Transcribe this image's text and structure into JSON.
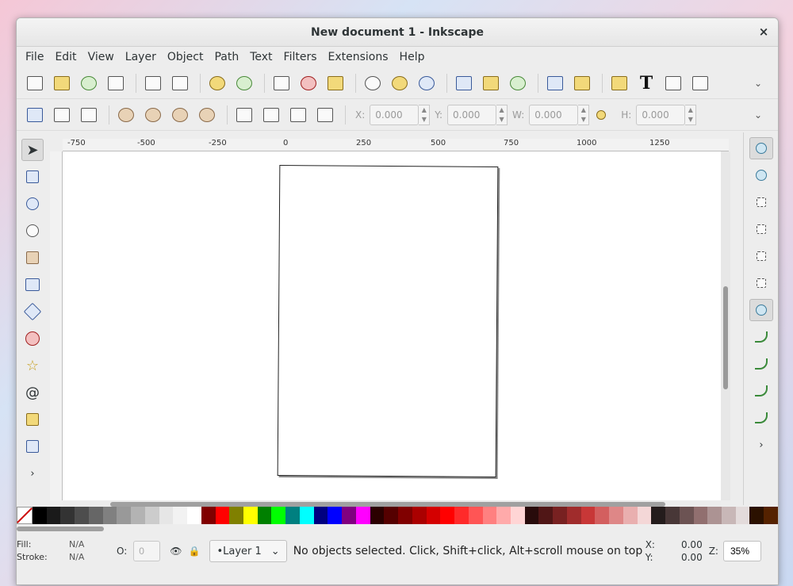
{
  "window": {
    "title": "New document 1 - Inkscape",
    "close": "×"
  },
  "menu": [
    "File",
    "Edit",
    "View",
    "Layer",
    "Object",
    "Path",
    "Text",
    "Filters",
    "Extensions",
    "Help"
  ],
  "toolbar": {
    "text_tool_glyph": "T",
    "more": "⌄"
  },
  "coords": {
    "x_label": "X:",
    "x_value": "0.000",
    "y_label": "Y:",
    "y_value": "0.000",
    "w_label": "W:",
    "w_value": "0.000",
    "h_label": "H:",
    "h_value": "0.000",
    "more": "⌄"
  },
  "ruler": {
    "labels": [
      "-750",
      "-500",
      "-250",
      "0",
      "250",
      "500",
      "750",
      "1000",
      "1250"
    ]
  },
  "palette": [
    "#000000",
    "#1a1a1a",
    "#333333",
    "#4d4d4d",
    "#666666",
    "#808080",
    "#999999",
    "#b3b3b3",
    "#cccccc",
    "#e6e6e6",
    "#f2f2f2",
    "#ffffff",
    "#800000",
    "#ff0000",
    "#808000",
    "#ffff00",
    "#008000",
    "#00ff00",
    "#008080",
    "#00ffff",
    "#000080",
    "#0000ff",
    "#800080",
    "#ff00ff",
    "#2b0000",
    "#550000",
    "#800000",
    "#aa0000",
    "#d40000",
    "#ff0000",
    "#ff2a2a",
    "#ff5555",
    "#ff8080",
    "#ffaaaa",
    "#ffd5d5",
    "#280b0b",
    "#501616",
    "#782121",
    "#a02c2c",
    "#c83737",
    "#d35f5f",
    "#de8787",
    "#e9afaf",
    "#f4d7d7",
    "#241c1c",
    "#483737",
    "#6c5353",
    "#916f6f",
    "#ac9393",
    "#c8b7b7",
    "#e3dbdb",
    "#2b1100",
    "#552200"
  ],
  "status": {
    "fill_label": "Fill:",
    "fill_value": "N/A",
    "stroke_label": "Stroke:",
    "stroke_value": "N/A",
    "opacity_label": "O:",
    "opacity_value": "0",
    "layer": "•Layer 1",
    "message": "No objects selected. Click, Shift+click, Alt+scroll mouse on top ...",
    "x_label": "X:",
    "x_value": "0.00",
    "y_label": "Y:",
    "y_value": "0.00",
    "zoom_label": "Z:",
    "zoom_value": "35%"
  }
}
